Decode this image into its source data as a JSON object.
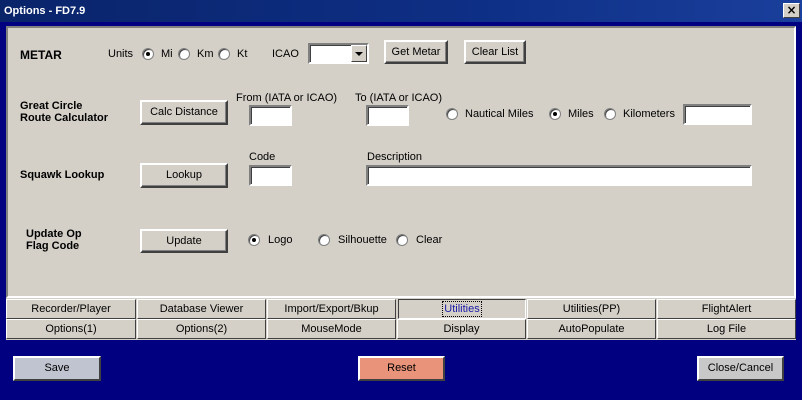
{
  "window": {
    "title": "Options - FD7.9",
    "close_glyph": "×"
  },
  "metar": {
    "heading": "METAR",
    "units_label": "Units",
    "units": [
      "Mi",
      "Km",
      "Kt"
    ],
    "selected_unit": "Mi",
    "icao_label": "ICAO",
    "icao_value": "",
    "get_metar_label": "Get Metar",
    "clear_list_label": "Clear List"
  },
  "gc": {
    "heading_line1": "Great Circle",
    "heading_line2": "Route Calculator",
    "calc_label": "Calc Distance",
    "from_label": "From (IATA or ICAO)",
    "from_value": "",
    "to_label": "To (IATA or ICAO)",
    "to_value": "",
    "units": [
      "Nautical Miles",
      "Miles",
      "Kilometers"
    ],
    "selected_unit": "Miles",
    "result_value": ""
  },
  "squawk": {
    "heading": "Squawk Lookup",
    "lookup_label": "Lookup",
    "code_label": "Code",
    "code_value": "",
    "description_label": "Description",
    "description_value": ""
  },
  "flag": {
    "heading_line1": "Update Op",
    "heading_line2": "Flag Code",
    "update_label": "Update",
    "options": [
      "Logo",
      "Silhouette",
      "Clear"
    ],
    "selected": "Logo"
  },
  "tabs": {
    "row1": [
      "Recorder/Player",
      "Database Viewer",
      "Import/Export/Bkup",
      "Utilities",
      "Utilities(PP)",
      "FlightAlert"
    ],
    "row2": [
      "Options(1)",
      "Options(2)",
      "MouseMode",
      "Display",
      "AutoPopulate",
      "Log File"
    ],
    "active": "Utilities"
  },
  "buttons": {
    "save": "Save",
    "reset": "Reset",
    "close_cancel": "Close/Cancel"
  },
  "colors": {
    "window_bg": "#000080",
    "panel_bg": "#d4d0c8",
    "save_bg": "#c0c4d0",
    "reset_bg": "#e8937a",
    "close_bg": "#c8c8c8"
  }
}
